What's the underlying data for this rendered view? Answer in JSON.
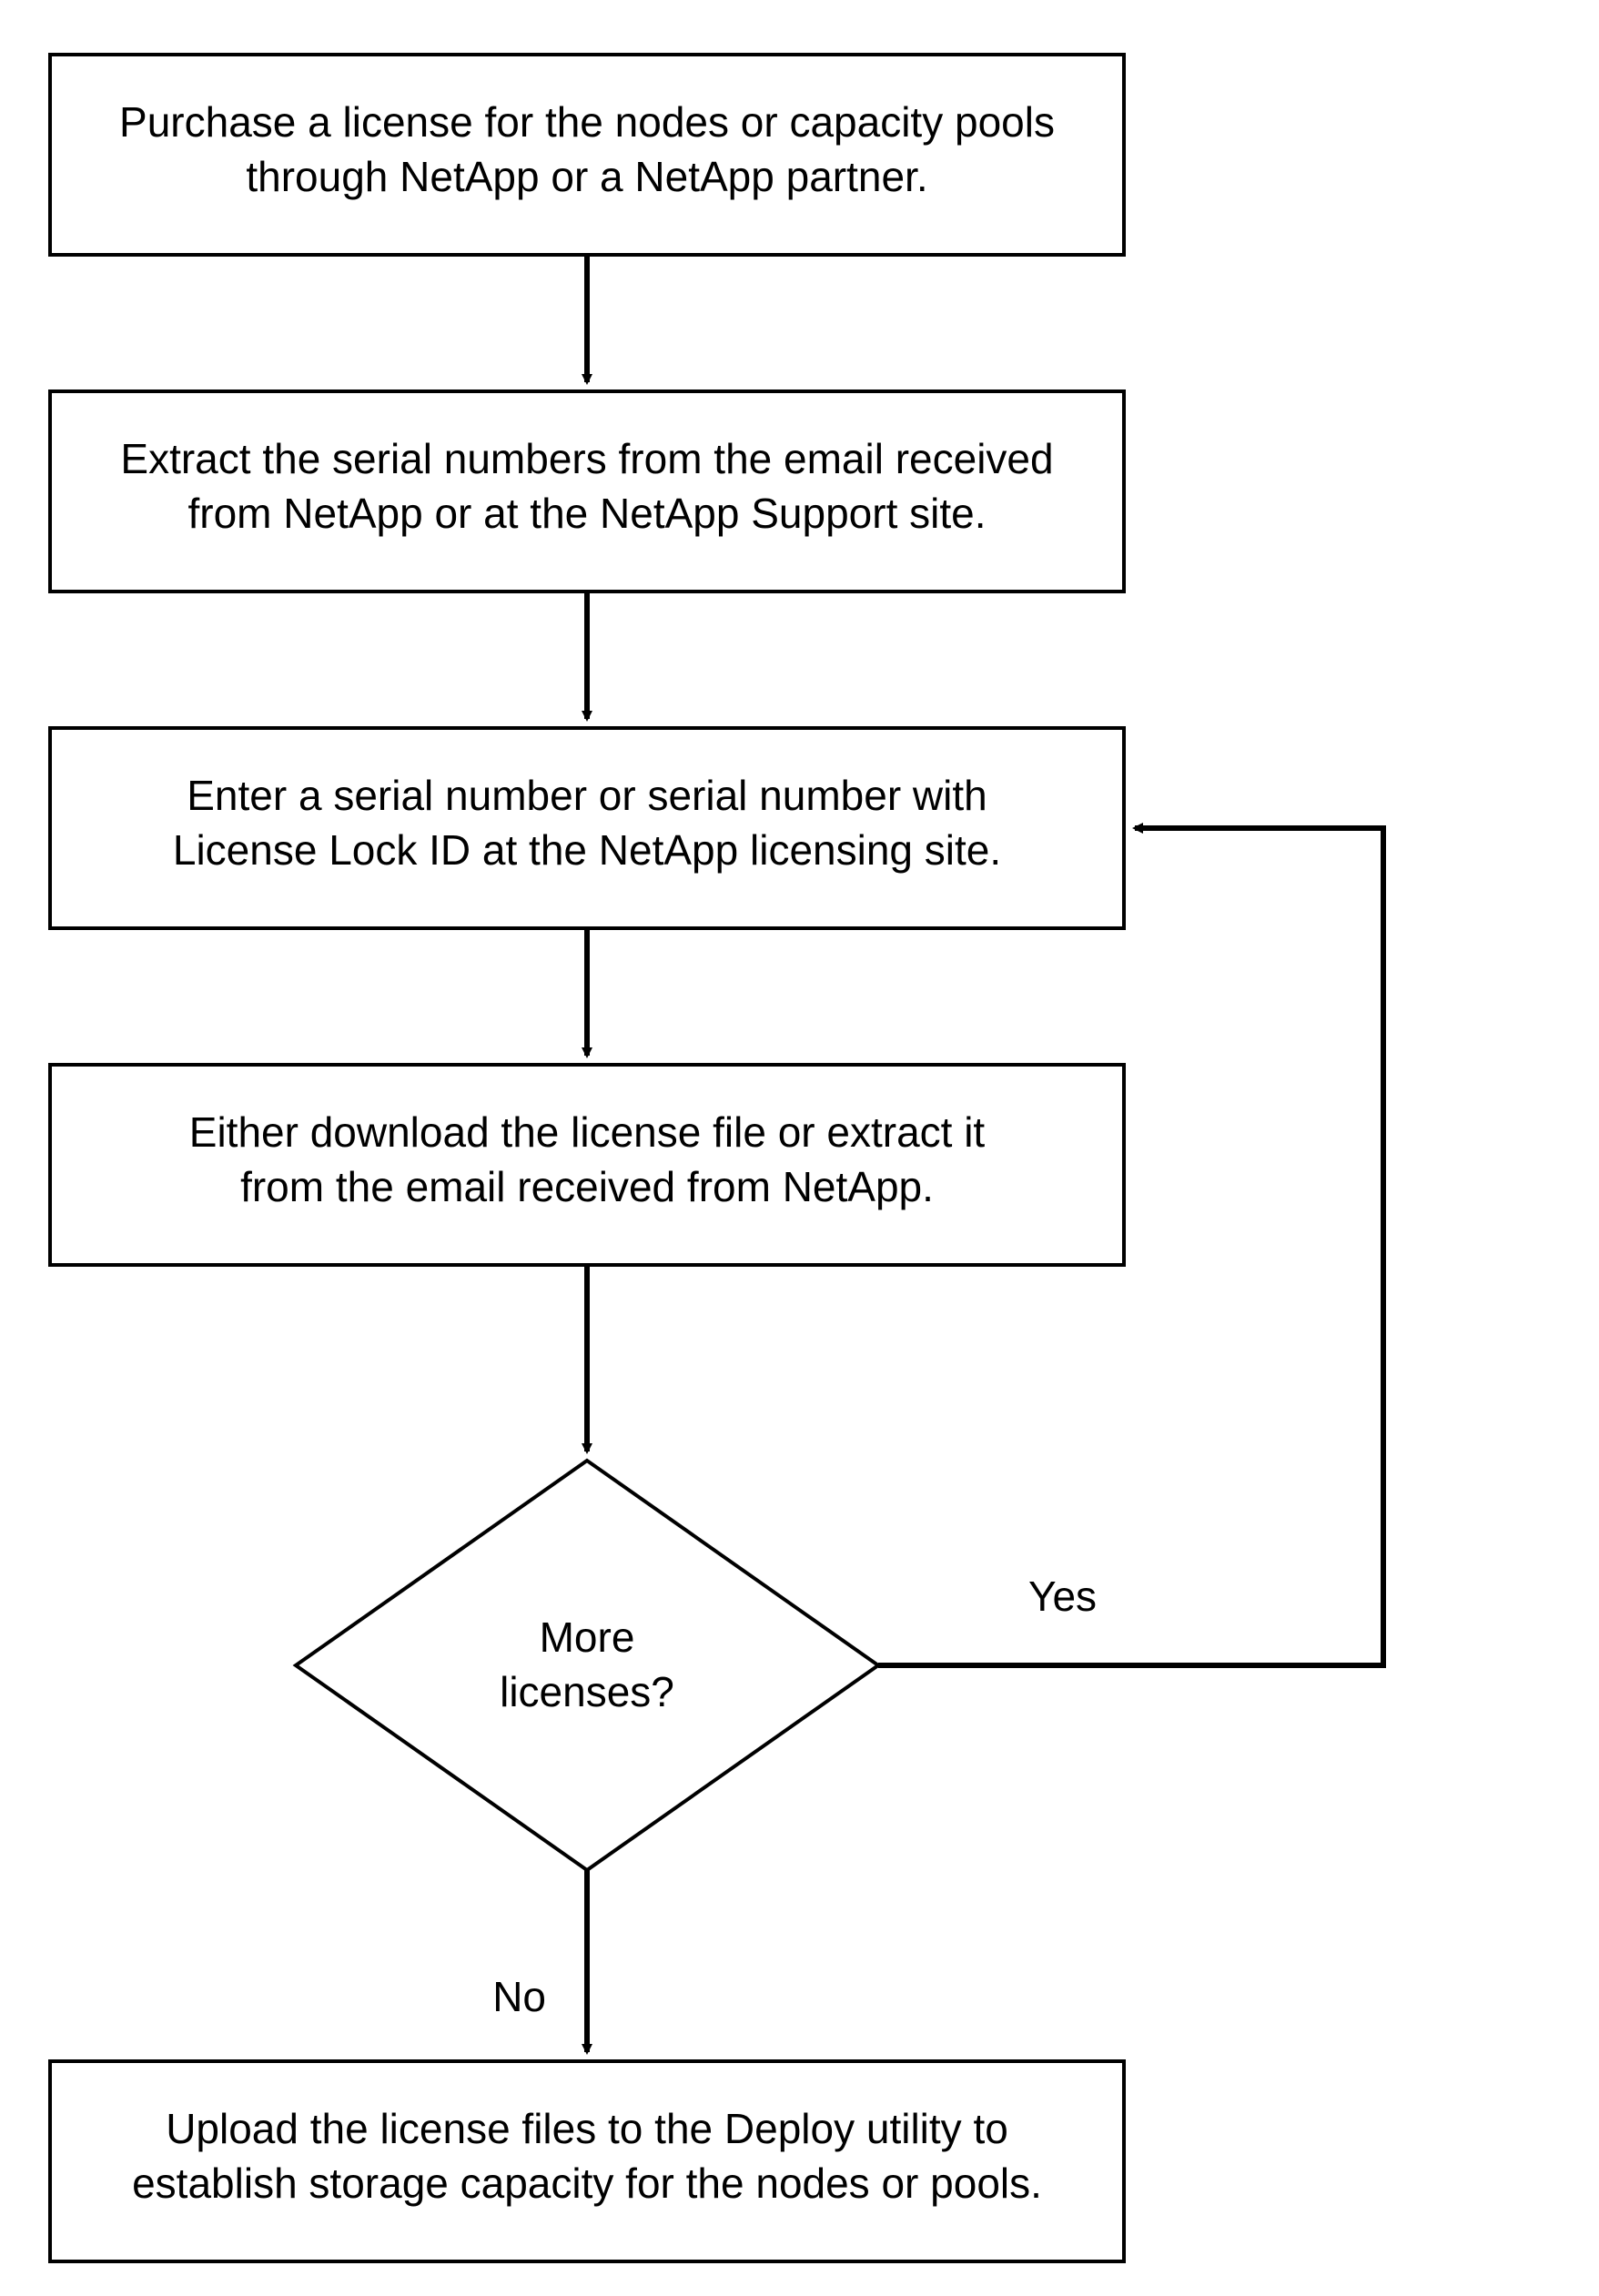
{
  "flow": {
    "step1": {
      "line1": "Purchase a license for the nodes or capacity pools",
      "line2": "through NetApp or a NetApp partner."
    },
    "step2": {
      "line1": "Extract the serial numbers from the email received",
      "line2": "from NetApp or at the NetApp Support site."
    },
    "step3": {
      "line1": "Enter a serial number or serial number with",
      "line2": "License Lock ID at the NetApp licensing site."
    },
    "step4": {
      "line1": "Either download the license file or extract it",
      "line2": "from the email received from NetApp."
    },
    "decision": {
      "line1": "More",
      "line2": "licenses?",
      "yes": "Yes",
      "no": "No"
    },
    "step5": {
      "line1": "Upload the license files to the Deploy utility to",
      "line2": "establish storage capacity for the nodes or pools."
    }
  }
}
